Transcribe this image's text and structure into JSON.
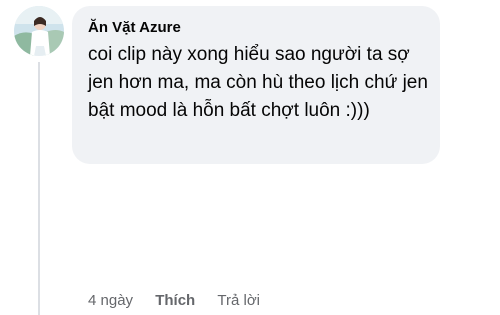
{
  "comment": {
    "author": "Ăn Vặt Azure",
    "text": "coi clip này xong hiểu sao người ta sợ jen hơn ma, ma còn hù theo lịch chứ jen bật mood là hỗn bất chợt luôn :)))",
    "timestamp": "4 ngày",
    "like_label": "Thích",
    "reply_label": "Trả lời"
  },
  "colors": {
    "bubble_bg": "#f0f2f5",
    "text": "#050505",
    "secondary_text": "#65676b",
    "thread_line": "#dcdfe4"
  },
  "icons": {
    "avatar": "user-profile-photo"
  }
}
